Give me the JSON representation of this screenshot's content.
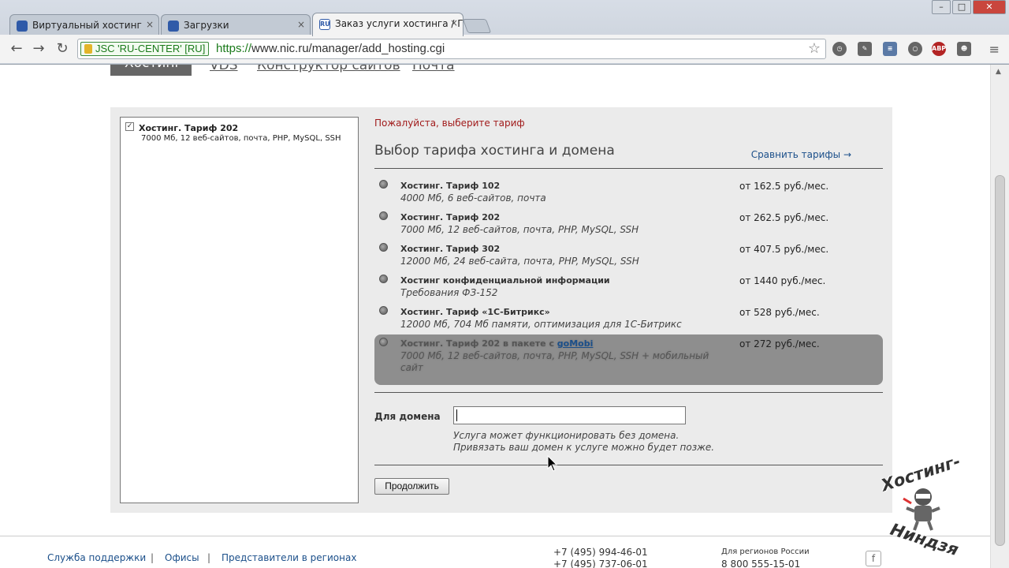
{
  "browser": {
    "tabs": [
      {
        "label": "Виртуальный хостинг"
      },
      {
        "label": "Загрузки"
      },
      {
        "label": "Заказ услуги хостинга / Г"
      }
    ],
    "ev_badge": "JSC 'RU-CENTER' [RU]",
    "url_scheme": "https://",
    "url_rest": "www.nic.ru/manager/add_hosting.cgi",
    "extensions": [
      "clock-icon",
      "evernote-icon",
      "rss-icon",
      "circle-icon",
      "ABP",
      "mask-icon"
    ]
  },
  "nav": {
    "active": "Хостинг",
    "links": [
      "VDS",
      "Конструктор сайтов",
      "Почта"
    ]
  },
  "summary": {
    "checked": true,
    "title": "Хостинг. Тариф 202",
    "desc": "7000 Мб, 12 веб-сайтов, почта, PHP, MySQL, SSH"
  },
  "main": {
    "error": "Пожалуйста, выберите тариф",
    "title": "Выбор тарифа хостинга и домена",
    "compare": "Сравнить тарифы →",
    "tariffs": [
      {
        "name": "Хостинг. Тариф 102",
        "desc": "4000 Мб, 6 веб-сайтов, почта",
        "price": "от 162.5 руб./мес."
      },
      {
        "name": "Хостинг. Тариф 202",
        "desc": "7000 Мб, 12 веб-сайтов, почта, PHP, MySQL, SSH",
        "price": "от 262.5 руб./мес."
      },
      {
        "name": "Хостинг. Тариф 302",
        "desc": "12000 Мб, 24 веб-сайта, почта, PHP, MySQL, SSH",
        "price": "от 407.5 руб./мес."
      },
      {
        "name": "Хостинг конфиденциальной информации",
        "desc": "Требования ФЗ-152",
        "price": "от 1440 руб./мес."
      },
      {
        "name": "Хостинг. Тариф «1С-Битрикс»",
        "desc": "12000 Мб, 704 Мб памяти, оптимизация для 1С-Битрикс",
        "price": "от 528 руб./мес."
      }
    ],
    "gomobi": {
      "name": "Хостинг. Тариф 202 в пакете с ",
      "link": "goMobi",
      "desc": "7000 Мб, 12 веб-сайтов, почта, PHP, MySQL, SSH + мобильный сайт",
      "price": "от 272 руб./мес."
    },
    "domain_label": "Для домена",
    "domain_value": "",
    "domain_hint1": "Услуга может функционировать без домена.",
    "domain_hint2": "Привязать ваш домен к услуге можно будет позже.",
    "continue": "Продолжить"
  },
  "footer": {
    "links": [
      "Служба поддержки",
      "Офисы",
      "Представители в регионах"
    ],
    "sep": "|",
    "phone1": "+7 (495) 994-46-01",
    "phone2": "+7 (495) 737-06-01",
    "regions_label": "Для регионов России",
    "phone3": "8 800 555-15-01",
    "fb": "f"
  },
  "watermark": {
    "top": "Хостинг-",
    "bottom": "Ниндзя"
  }
}
